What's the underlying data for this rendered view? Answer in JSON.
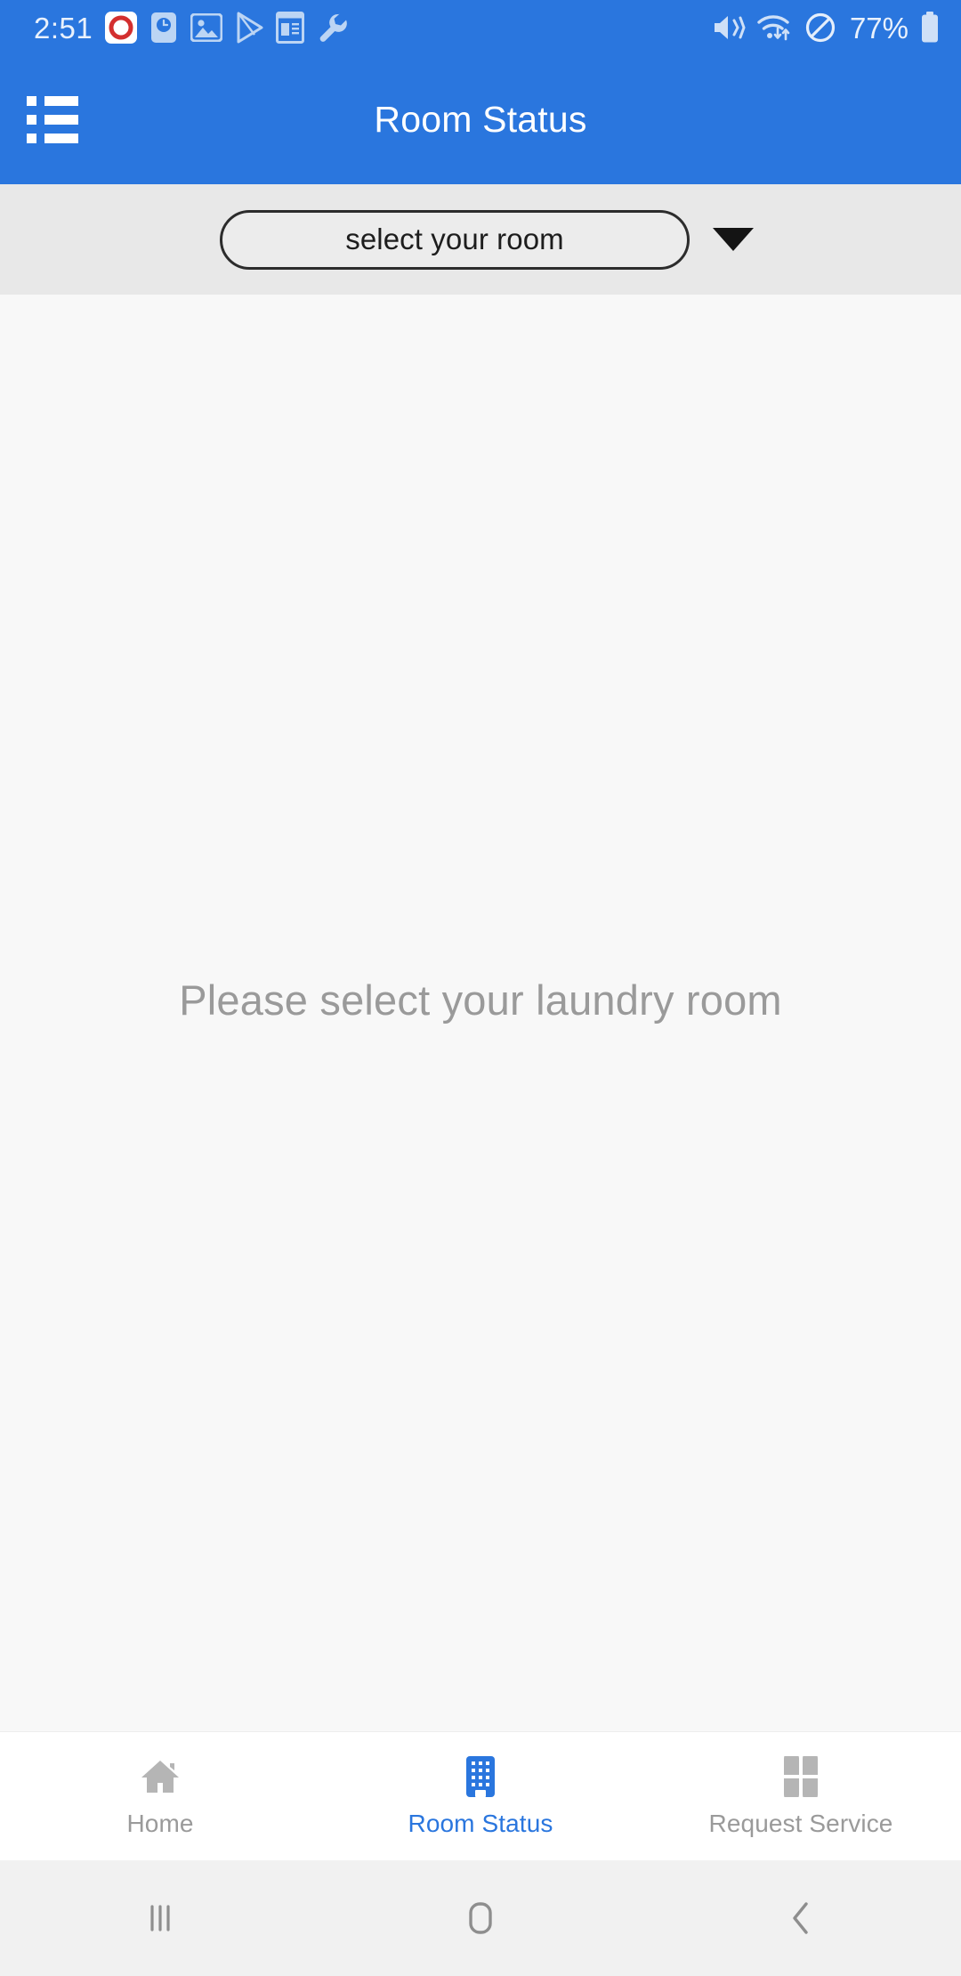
{
  "status_bar": {
    "time": "2:51",
    "battery_percent": "77%",
    "left_icons": [
      {
        "name": "app-logo-icon"
      },
      {
        "name": "clock-icon"
      },
      {
        "name": "gallery-image-icon"
      },
      {
        "name": "play-store-icon"
      },
      {
        "name": "news-reader-icon"
      },
      {
        "name": "wrench-tool-icon"
      }
    ],
    "right_icons": [
      {
        "name": "mute-vibrate-icon"
      },
      {
        "name": "wifi-data-transfer-icon"
      },
      {
        "name": "do-not-disturb-icon"
      },
      {
        "name": "battery-icon"
      }
    ]
  },
  "app_bar": {
    "title": "Room Status",
    "menu_icon": "list-menu-icon"
  },
  "selector": {
    "room_value": "select your room",
    "caret_icon": "chevron-down-icon"
  },
  "content": {
    "empty_message": "Please select your laundry room"
  },
  "bottom_nav": {
    "items": [
      {
        "label": "Home",
        "icon": "home-icon",
        "active": false
      },
      {
        "label": "Room Status",
        "icon": "building-icon",
        "active": true
      },
      {
        "label": "Request Service",
        "icon": "clover-grid-icon",
        "active": false
      }
    ]
  },
  "android_nav": {
    "recents": "recents-icon",
    "home": "home-square-icon",
    "back": "back-chevron-icon"
  },
  "colors": {
    "brand_blue": "#2a76de",
    "strip_gray": "#e8e8e8",
    "content_gray": "#f8f8f8",
    "muted_text": "#9a9a9a"
  }
}
